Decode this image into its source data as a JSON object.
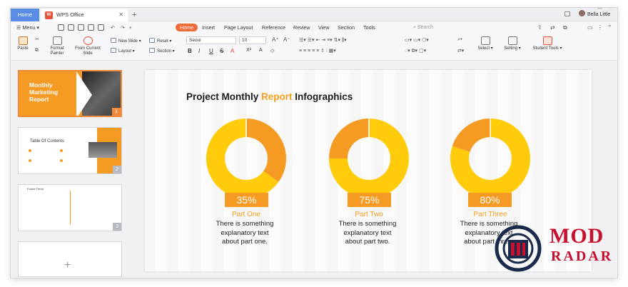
{
  "window": {
    "home_tab": "Home",
    "doc_tab": "WPS Office",
    "user_name": "Bella Little"
  },
  "menu": {
    "menu_label": "Menu",
    "tabs": [
      "Home",
      "Insert",
      "Page Layout",
      "Reference",
      "Review",
      "View",
      "Section",
      "Tools"
    ],
    "search_placeholder": "Search"
  },
  "ribbon": {
    "paste": "Paste",
    "format_painter": "Format Painter",
    "from_current_slide": "From Current Slide",
    "new_slide": "New Slide",
    "layout": "Layout",
    "reset": "Reset",
    "section": "Section",
    "font": "Seoui",
    "size": "10",
    "select": "Select",
    "setting": "Setting",
    "student_tools": "Student Tools"
  },
  "thumbnails": [
    {
      "num": "1",
      "title_line1": "Monthly",
      "title_line2": "Marketing",
      "title_line3": "Report"
    },
    {
      "num": "2",
      "title": "Table Of Contents"
    },
    {
      "num": "3",
      "title": "Future Trend"
    },
    {
      "num": ""
    }
  ],
  "slide": {
    "title_pre": "Project Monthly ",
    "title_hl": "Report",
    "title_post": " Infographics",
    "items": [
      {
        "pct": "35%",
        "part": "Part One",
        "desc_line1": "There is something",
        "desc_line2": "explanatory text",
        "desc_line3": "about part one."
      },
      {
        "pct": "75%",
        "part": "Part Two",
        "desc_line1": "There is something",
        "desc_line2": "explanatory text",
        "desc_line3": "about part two."
      },
      {
        "pct": "80%",
        "part": "Part Three",
        "desc_line1": "There is something",
        "desc_line2": "explanatory text",
        "desc_line3": "about part three."
      }
    ],
    "donut_values": [
      0.35,
      0.75,
      0.8
    ]
  },
  "watermark": {
    "line1": "MOD",
    "line2": "RADAR"
  },
  "colors": {
    "accent": "#f06b3a",
    "orange": "#f59a23",
    "yellow": "#ffcb0a",
    "brand_red": "#c8102e"
  }
}
